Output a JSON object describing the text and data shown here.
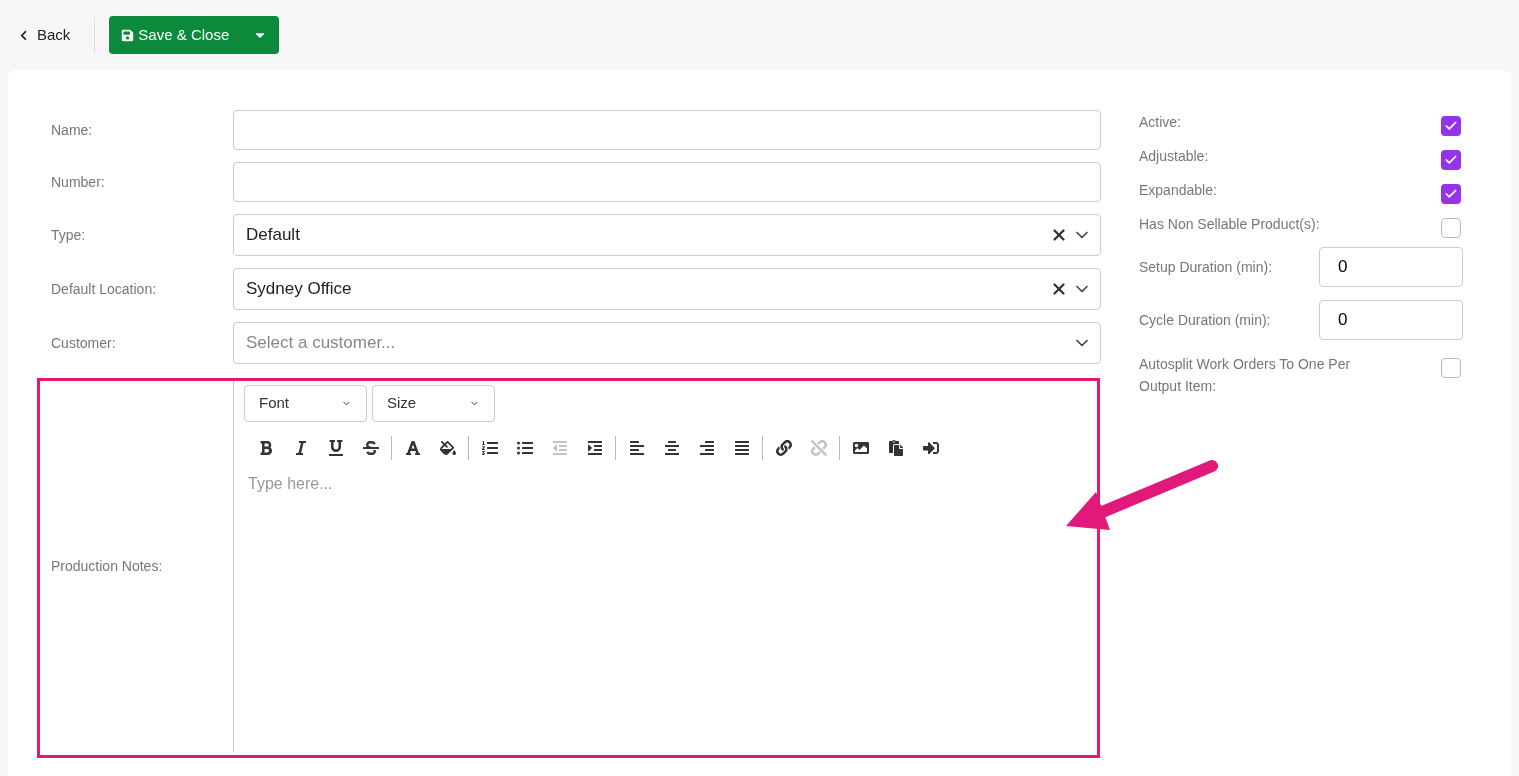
{
  "header": {
    "back": "Back",
    "save": "Save & Close"
  },
  "fields": [
    {
      "label": "Name:",
      "kind": "text"
    },
    {
      "label": "Number:",
      "kind": "text"
    },
    {
      "label": "Type:",
      "kind": "select",
      "value": "Default",
      "clearable": true
    },
    {
      "label": "Default Location:",
      "kind": "select",
      "value": "Sydney Office",
      "clearable": true
    },
    {
      "label": "Customer:",
      "kind": "select",
      "placeholder": "Select a customer...",
      "clearable": false
    }
  ],
  "editor": {
    "label": "Production Notes:",
    "font": "Font",
    "size": "Size",
    "placeholder": "Type here...",
    "toolbar": [
      [
        {
          "kind": "bold",
          "disabled": false
        },
        {
          "kind": "italic",
          "disabled": false
        },
        {
          "kind": "underline",
          "disabled": false
        },
        {
          "kind": "strike",
          "disabled": false
        }
      ],
      [
        {
          "kind": "font-color",
          "disabled": false
        },
        {
          "kind": "back-color",
          "disabled": false
        }
      ],
      [
        {
          "kind": "ordered-list",
          "disabled": false
        },
        {
          "kind": "bullet-list",
          "disabled": false
        },
        {
          "kind": "outdent",
          "disabled": true
        },
        {
          "kind": "indent",
          "disabled": false
        }
      ],
      [
        {
          "kind": "align-left",
          "disabled": false
        },
        {
          "kind": "align-center",
          "disabled": false
        },
        {
          "kind": "align-right",
          "disabled": false
        },
        {
          "kind": "justify",
          "disabled": false
        }
      ],
      [
        {
          "kind": "link",
          "disabled": false
        },
        {
          "kind": "unlink",
          "disabled": true
        }
      ],
      [
        {
          "kind": "image",
          "disabled": false
        },
        {
          "kind": "paste",
          "disabled": false
        },
        {
          "kind": "insert",
          "disabled": false
        }
      ]
    ]
  },
  "options": [
    {
      "label": "Active:",
      "kind": "checkbox",
      "checked": true
    },
    {
      "label": "Adjustable:",
      "kind": "checkbox",
      "checked": true
    },
    {
      "label": "Expandable:",
      "kind": "checkbox",
      "checked": true
    },
    {
      "label": "Has Non Sellable Product(s):",
      "kind": "checkbox",
      "checked": false
    },
    {
      "label": "Setup Duration (min):",
      "kind": "number",
      "value": "0"
    },
    {
      "label": "Cycle Duration (min):",
      "kind": "number",
      "value": "0"
    },
    {
      "label": "Autosplit Work Orders To One Per Output Item:",
      "kind": "checkbox",
      "checked": false
    }
  ]
}
